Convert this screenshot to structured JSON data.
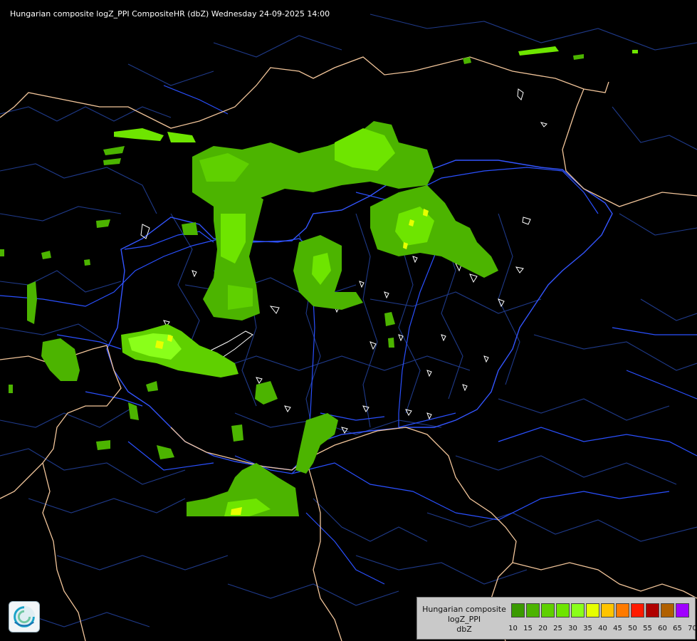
{
  "header": {
    "title": "Hungarian composite logZ_PPI CompositeHR (dbZ) Wednesday 24-09-2025 14:00"
  },
  "legend": {
    "title_lines": [
      "Hungarian composite",
      "logZ_PPI",
      "dbZ"
    ],
    "scale": [
      {
        "value": "10",
        "color": "#3a9a00"
      },
      {
        "value": "15",
        "color": "#4cb400"
      },
      {
        "value": "20",
        "color": "#5fd000"
      },
      {
        "value": "25",
        "color": "#6ee500"
      },
      {
        "value": "30",
        "color": "#8aff1a"
      },
      {
        "value": "35",
        "color": "#e6ff00"
      },
      {
        "value": "40",
        "color": "#ffc400"
      },
      {
        "value": "45",
        "color": "#ff7a00"
      },
      {
        "value": "50",
        "color": "#ff1a00"
      },
      {
        "value": "55",
        "color": "#b00000"
      },
      {
        "value": "60",
        "color": "#b06000"
      },
      {
        "value": "65",
        "color": "#a000ff"
      },
      {
        "value": "70",
        "color": "#b4b4ff"
      }
    ]
  },
  "logo": {
    "icon": "met-service-swirl-logo"
  },
  "colors": {
    "background": "#000000",
    "border_country": "#f2c59a",
    "border_region": "#1f3a8a",
    "rivers": "#2a50ff",
    "lakes": "#ffffff"
  }
}
